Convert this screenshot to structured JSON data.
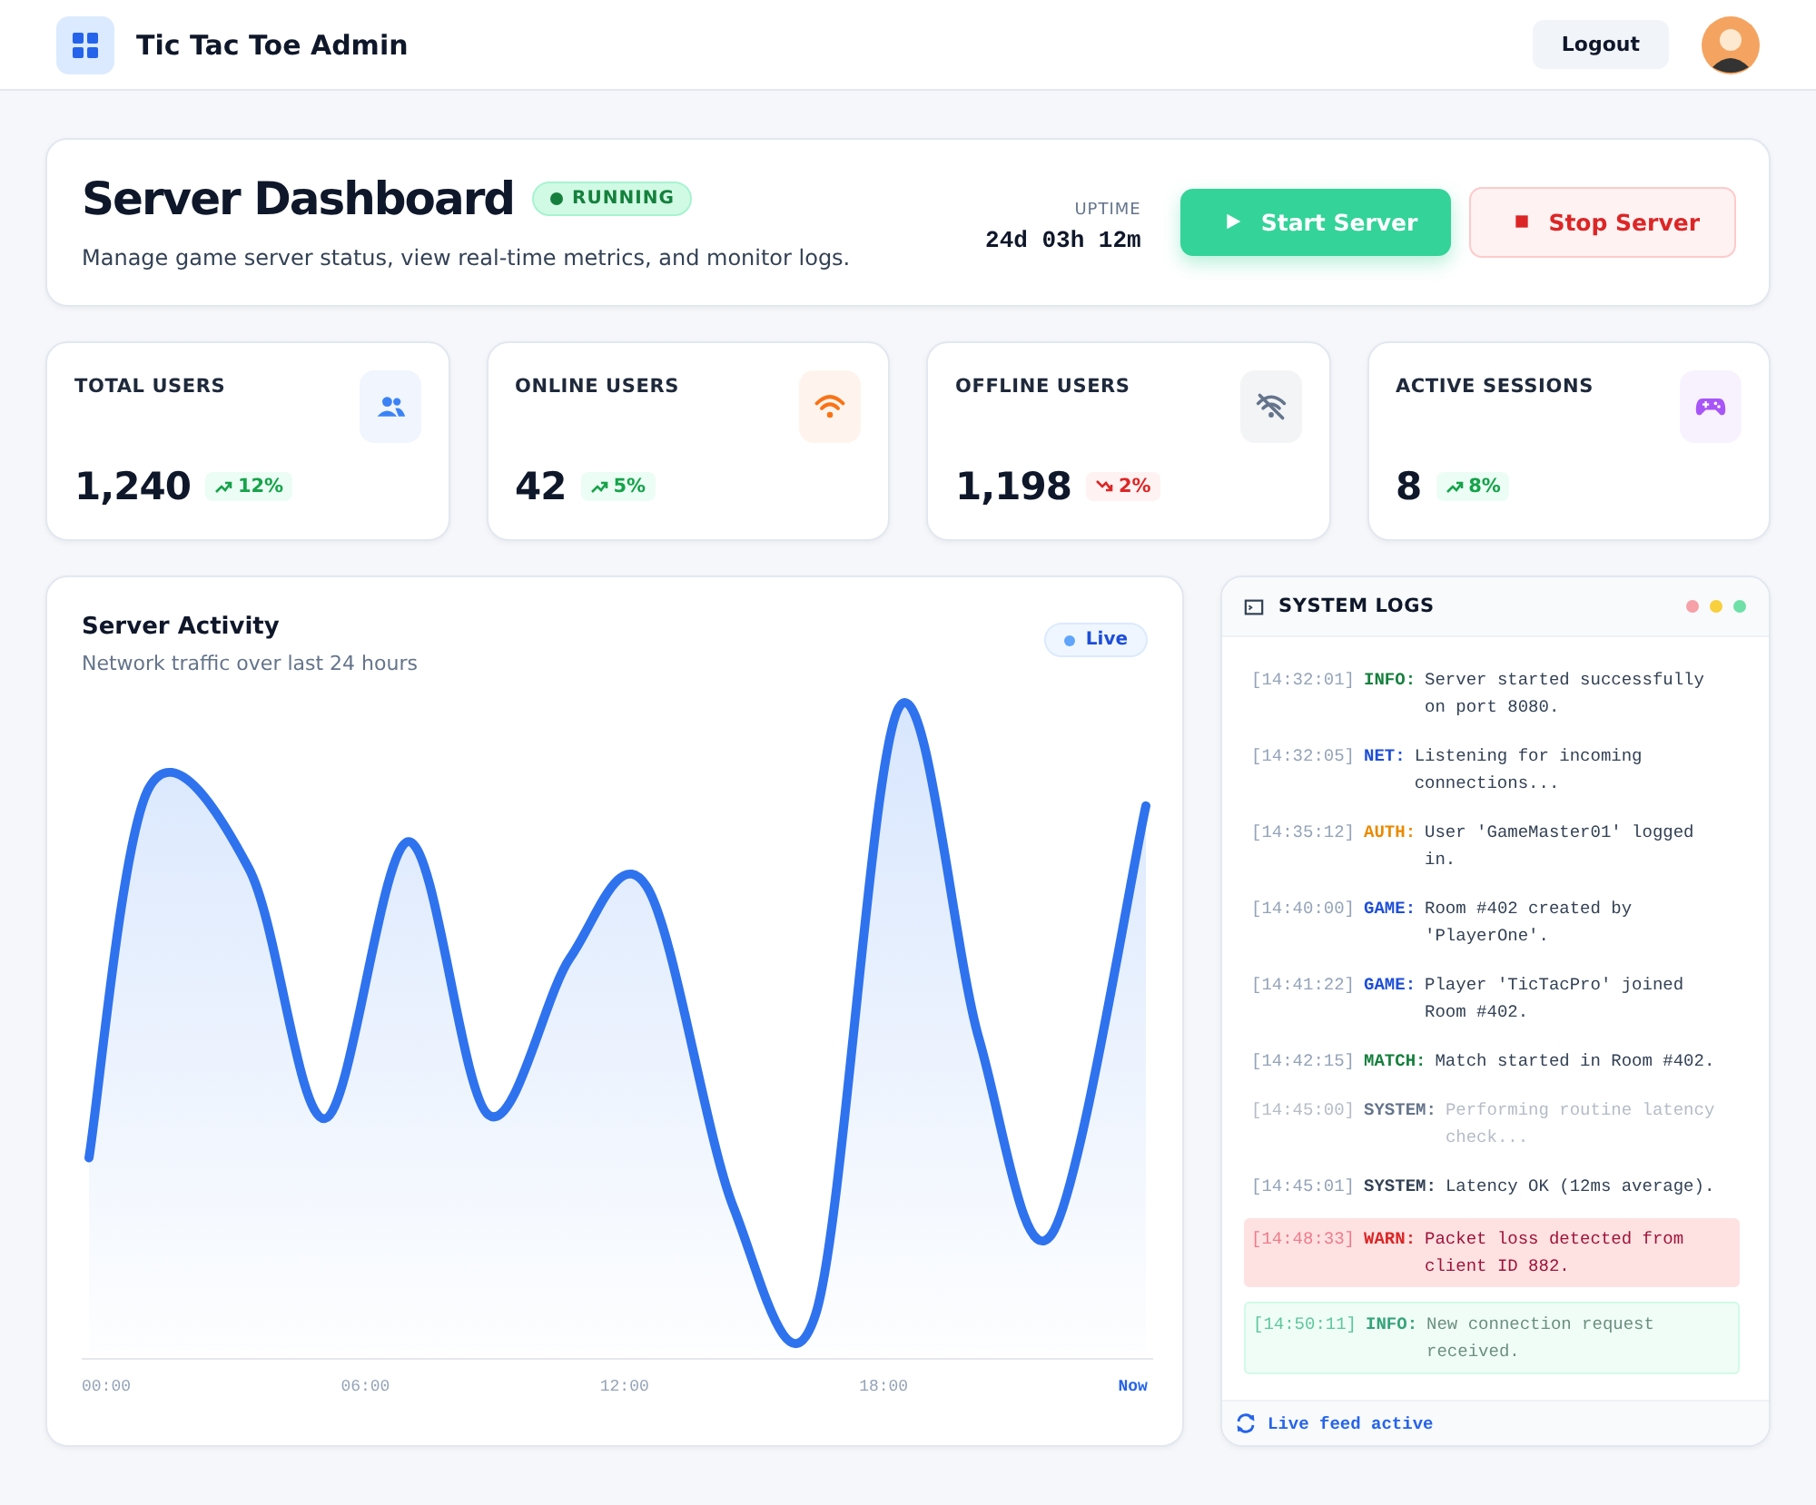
{
  "header": {
    "title": "Tic Tac Toe Admin",
    "logout": "Logout"
  },
  "hero": {
    "title": "Server Dashboard",
    "status": "RUNNING",
    "running": true,
    "subtitle": "Manage game server status, view real-time metrics, and monitor logs.",
    "uptime_label": "UPTIME",
    "uptime": "24d 03h 12m",
    "start": "Start Server",
    "stop": "Stop Server"
  },
  "stats": [
    {
      "label": "TOTAL USERS",
      "value": "1,240",
      "trend": "12%",
      "falling": false,
      "kind": "users",
      "color": "#3b82f6"
    },
    {
      "label": "ONLINE USERS",
      "value": "42",
      "trend": "5%",
      "falling": false,
      "kind": "wifi",
      "color": "#f97316"
    },
    {
      "label": "OFFLINE USERS",
      "value": "1,198",
      "trend": "2%",
      "falling": true,
      "kind": "wifi-off",
      "color": "#64748b"
    },
    {
      "label": "ACTIVE SESSIONS",
      "value": "8",
      "trend": "8%",
      "falling": false,
      "kind": "gamepad",
      "color": "#a855f7"
    }
  ],
  "activity": {
    "title": "Server Activity",
    "subtitle": "Network traffic over last 24 hours",
    "badge": "Live",
    "x_labels": [
      "00:00",
      "06:00",
      "12:00",
      "18:00",
      "Now"
    ]
  },
  "logs": {
    "title": "SYSTEM LOGS",
    "footer": "Live feed active",
    "entries": [
      {
        "time": "[14:32:01]",
        "tag": "INFO:",
        "color": "#15803d",
        "message": "Server started successfully on port 8080.",
        "kind": "plain"
      },
      {
        "time": "[14:32:05]",
        "tag": "NET:",
        "color": "#1d4ed8",
        "message": "Listening for incoming connections...",
        "kind": "plain"
      },
      {
        "time": "[14:35:12]",
        "tag": "AUTH:",
        "color": "#ea8a00",
        "message": "User 'GameMaster01' logged in.",
        "kind": "plain"
      },
      {
        "time": "[14:40:00]",
        "tag": "GAME:",
        "color": "#1d4ed8",
        "message": "Room #402 created by 'PlayerOne'.",
        "kind": "plain"
      },
      {
        "time": "[14:41:22]",
        "tag": "GAME:",
        "color": "#1d4ed8",
        "message": "Player 'TicTacPro' joined Room #402.",
        "kind": "plain"
      },
      {
        "time": "[14:42:15]",
        "tag": "MATCH:",
        "color": "#15803d",
        "message": "Match started in Room #402.",
        "kind": "plain"
      },
      {
        "time": "[14:45:00]",
        "tag": "SYSTEM:",
        "color": "#64748b",
        "message": "Performing routine latency check...",
        "kind": "faded"
      },
      {
        "time": "[14:45:01]",
        "tag": "SYSTEM:",
        "color": "#334155",
        "message": "Latency OK (12ms average).",
        "kind": "plain"
      },
      {
        "time": "[14:48:33]",
        "tag": "WARN:",
        "color": "#dc2626",
        "message": "Packet loss detected from client ID 882.",
        "kind": "warn"
      },
      {
        "time": "[14:50:11]",
        "tag": "INFO:",
        "color": "#34a37a",
        "message": "New connection request received.",
        "kind": "success"
      }
    ]
  }
}
